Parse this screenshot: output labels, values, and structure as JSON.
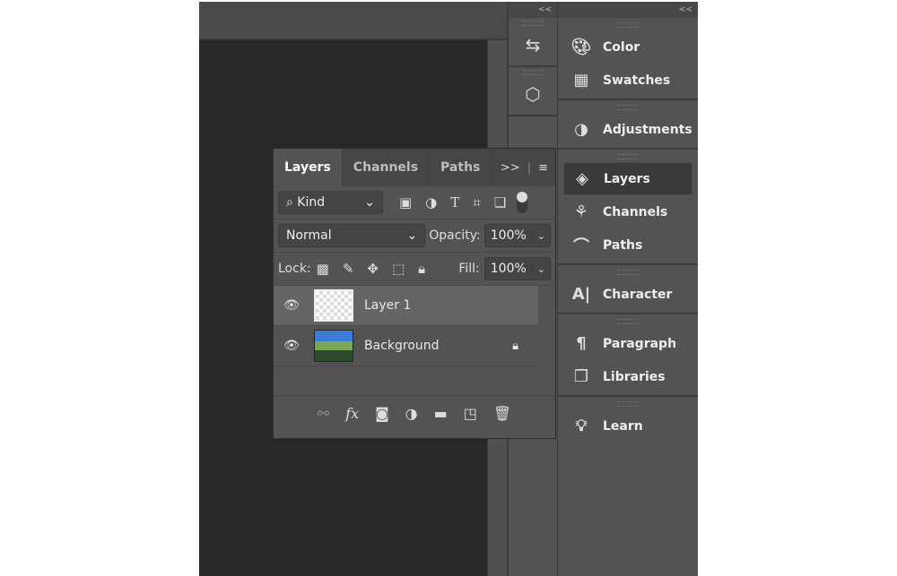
{
  "dock": {
    "collapse_left": "<<",
    "collapse_right": "<<"
  },
  "icon_column": [
    {
      "icon": "history-icon"
    },
    {
      "icon": "3d-properties-icon"
    }
  ],
  "panel_groups": [
    [
      {
        "label": "Color",
        "icon": "palette-icon"
      },
      {
        "label": "Swatches",
        "icon": "grid-icon"
      }
    ],
    [
      {
        "label": "Adjustments",
        "icon": "adjustments-icon"
      }
    ],
    [
      {
        "label": "Layers",
        "icon": "layers-icon",
        "active": true
      },
      {
        "label": "Channels",
        "icon": "channels-icon"
      },
      {
        "label": "Paths",
        "icon": "pen-path-icon"
      }
    ],
    [
      {
        "label": "Character",
        "icon": "character-icon"
      }
    ],
    [
      {
        "label": "Paragraph",
        "icon": "pilcrow-icon"
      },
      {
        "label": "Libraries",
        "icon": "libraries-icon"
      }
    ],
    [
      {
        "label": "Learn",
        "icon": "lightbulb-icon"
      }
    ]
  ],
  "layers_panel": {
    "tabs": [
      "Layers",
      "Channels",
      "Paths"
    ],
    "active_tab": "Layers",
    "filter": {
      "value": "Kind"
    },
    "blend_mode": "Normal",
    "opacity_label": "Opacity:",
    "opacity": "100%",
    "lock_label": "Lock:",
    "fill_label": "Fill:",
    "fill": "100%",
    "layers": [
      {
        "name": "Layer 1",
        "visible": true,
        "selected": true,
        "locked": false
      },
      {
        "name": "Background",
        "visible": true,
        "selected": false,
        "locked": true
      }
    ]
  }
}
